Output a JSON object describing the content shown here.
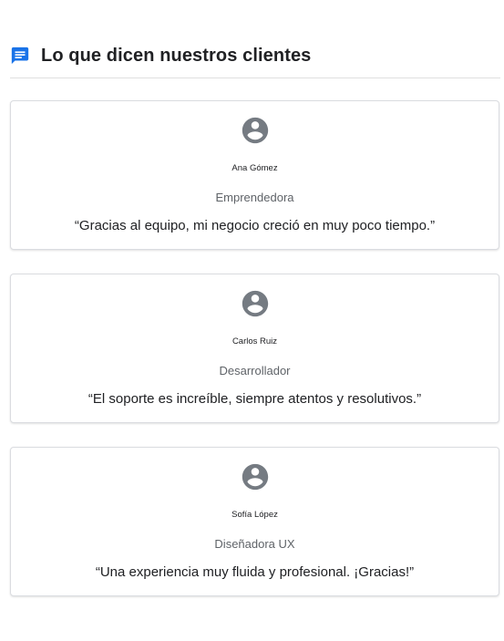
{
  "section": {
    "title": "Lo que dicen nuestros clientes",
    "icon": "chat-bubble-icon",
    "accent_color": "#1a73e8"
  },
  "testimonials": [
    {
      "avatar_icon": "account-circle-icon",
      "name": "Ana Gómez",
      "role": "Emprendedora",
      "quote": "“Gracias al equipo, mi negocio creció en muy poco tiempo.”"
    },
    {
      "avatar_icon": "account-circle-icon",
      "name": "Carlos Ruiz",
      "role": "Desarrollador",
      "quote": "“El soporte es increíble, siempre atentos y resolutivos.”"
    },
    {
      "avatar_icon": "account-circle-icon",
      "name": "Sofía López",
      "role": "Diseñadora UX",
      "quote": "“Una experiencia muy fluida y profesional. ¡Gracias!”"
    }
  ]
}
